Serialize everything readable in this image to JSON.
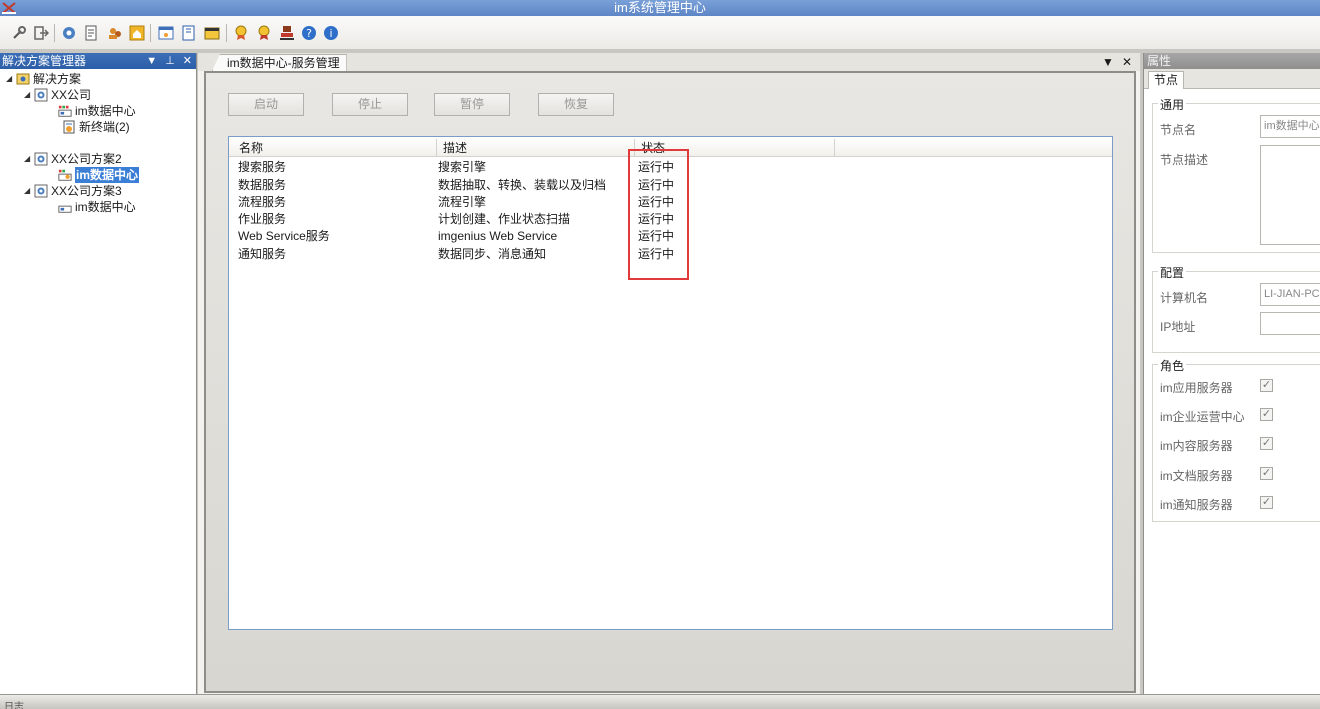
{
  "window": {
    "title": "im系统管理中心"
  },
  "toolbar": {
    "icons": [
      "tool-icon",
      "exit-icon",
      "gear-icon",
      "document-icon",
      "users-icon",
      "home-icon",
      "window-icon",
      "bookmark-icon",
      "calendar-icon",
      "award-icon",
      "award-star-icon",
      "stamp-icon",
      "help-icon",
      "info-icon"
    ]
  },
  "explorer": {
    "title": "解决方案管理器",
    "tree": {
      "root": "解决方案",
      "company1": "XX公司",
      "company1_dc": "im数据中心",
      "company1_terminal": "新终端(2)",
      "company2": "XX公司方案2",
      "company2_dc": "im数据中心",
      "company3": "XX公司方案3",
      "company3_dc": "im数据中心"
    }
  },
  "document": {
    "tab_label": "im数据中心-服务管理",
    "buttons": {
      "start": "启动",
      "stop": "停止",
      "pause": "暂停",
      "resume": "恢复"
    },
    "columns": {
      "name": "名称",
      "desc": "描述",
      "status": "状态"
    },
    "rows": [
      {
        "name": "搜索服务",
        "desc": "搜索引擎",
        "status": "运行中"
      },
      {
        "name": "数据服务",
        "desc": "数据抽取、转换、装载以及归档",
        "status": "运行中"
      },
      {
        "name": "流程服务",
        "desc": "流程引擎",
        "status": "运行中"
      },
      {
        "name": "作业服务",
        "desc": "计划创建、作业状态扫描",
        "status": "运行中"
      },
      {
        "name": "Web Service服务",
        "desc": "imgenius Web Service",
        "status": "运行中"
      },
      {
        "name": "通知服务",
        "desc": "数据同步、消息通知",
        "status": "运行中"
      }
    ],
    "highlight_color": "#e03a3a"
  },
  "properties": {
    "title": "属性",
    "tab": "节点",
    "general": {
      "title": "通用",
      "node_name_label": "节点名",
      "node_name_value": "im数据中心",
      "node_desc_label": "节点描述"
    },
    "config": {
      "title": "配置",
      "computer_label": "计算机名",
      "computer_value": "LI-JIAN-PC",
      "ip_label": "IP地址"
    },
    "roles": {
      "title": "角色",
      "items": [
        "im应用服务器",
        "im企业运营中心",
        "im内容服务器",
        "im文档服务器",
        "im通知服务器"
      ]
    }
  },
  "statusbar": {
    "text": "日志"
  }
}
